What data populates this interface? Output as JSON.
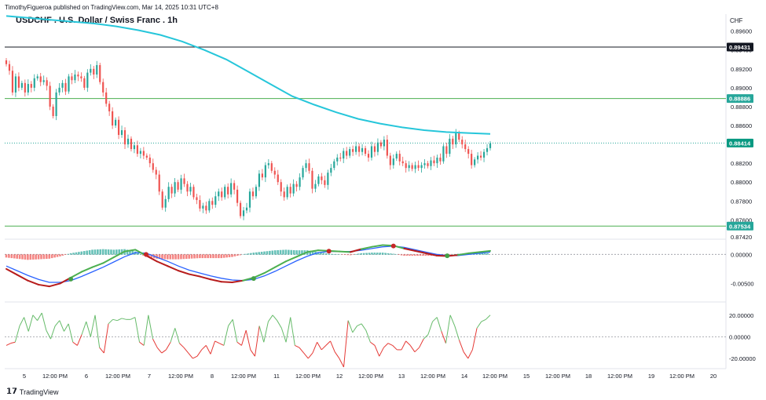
{
  "header": {
    "publisher": "TimothyFigueroa published on TradingView.com, Mar 14, 2025 10:31 UTC+8",
    "title": "USDCHF . U.S. Dollar / Swiss Franc . 1h",
    "currency": "CHF"
  },
  "footer": {
    "brand": "TradingView",
    "logo_icon": "tradingview-logo-icon"
  },
  "colors": {
    "up": "#26a69a",
    "down": "#ef5350",
    "ma": "#26c6da",
    "resistance": "#131722",
    "support": "#4caf50",
    "macd_fast": "#4caf50",
    "macd_slow": "#2962ff",
    "macd_slow_down": "#b71c1c",
    "osc_up": "#66bb6a",
    "osc_down": "#e53935",
    "grid": "#f0f3fa"
  },
  "chart_data": [
    {
      "type": "candlestick",
      "panel": "price",
      "ylim": [
        0.8742,
        0.8978
      ],
      "y_ticks": [
        "0.89600",
        "0.89400",
        "0.89200",
        "0.89000",
        "0.88800",
        "0.88600",
        "0.88400",
        "0.88200",
        "0.88000",
        "0.87800",
        "0.87600",
        "0.87420"
      ],
      "x_ticks": [
        "5",
        "12:00 PM",
        "6",
        "12:00 PM",
        "7",
        "12:00 PM",
        "8",
        "12:00 PM",
        "11",
        "12:00 PM",
        "12",
        "12:00 PM",
        "13",
        "12:00 PM",
        "14",
        "12:00 PM",
        "15",
        "12:00 PM",
        "18",
        "12:00 PM",
        "19",
        "12:00 PM",
        "20"
      ],
      "close_path": [
        0.8925,
        0.8918,
        0.8895,
        0.8912,
        0.89,
        0.8905,
        0.8895,
        0.8904,
        0.89,
        0.891,
        0.8912,
        0.8906,
        0.8908,
        0.8902,
        0.888,
        0.887,
        0.8895,
        0.89,
        0.8905,
        0.8896,
        0.8912,
        0.8908,
        0.8914,
        0.8912,
        0.891,
        0.89,
        0.8916,
        0.892,
        0.8914,
        0.8924,
        0.8906,
        0.8895,
        0.8883,
        0.8875,
        0.886,
        0.8866,
        0.885,
        0.8855,
        0.884,
        0.8846,
        0.8835,
        0.8839,
        0.883,
        0.8833,
        0.8828,
        0.8826,
        0.882,
        0.8813,
        0.8808,
        0.879,
        0.8773,
        0.8782,
        0.8795,
        0.8788,
        0.88,
        0.8792,
        0.8804,
        0.8798,
        0.879,
        0.8795,
        0.8784,
        0.8781,
        0.8772,
        0.8775,
        0.877,
        0.878,
        0.8776,
        0.8785,
        0.879,
        0.8784,
        0.8795,
        0.8787,
        0.8799,
        0.8792,
        0.8778,
        0.8764,
        0.877,
        0.8773,
        0.879,
        0.8785,
        0.8795,
        0.8809,
        0.8805,
        0.8818,
        0.882,
        0.8812,
        0.8808,
        0.88,
        0.879,
        0.8784,
        0.8795,
        0.8788,
        0.8798,
        0.8795,
        0.8805,
        0.8815,
        0.882,
        0.8812,
        0.8793,
        0.8798,
        0.8806,
        0.8802,
        0.8797,
        0.881,
        0.8815,
        0.8822,
        0.8826,
        0.8825,
        0.8833,
        0.8828,
        0.8835,
        0.8832,
        0.8838,
        0.8832,
        0.8836,
        0.883,
        0.8826,
        0.8838,
        0.8832,
        0.8842,
        0.8838,
        0.8845,
        0.8828,
        0.8818,
        0.8825,
        0.883,
        0.8822,
        0.882,
        0.8815,
        0.8818,
        0.8814,
        0.8818,
        0.8815,
        0.8818,
        0.882,
        0.8817,
        0.8823,
        0.882,
        0.8826,
        0.8822,
        0.8838,
        0.883,
        0.8846,
        0.884,
        0.8852,
        0.8845,
        0.884,
        0.8835,
        0.883,
        0.8818,
        0.8824,
        0.8828,
        0.8826,
        0.8832,
        0.8836,
        0.8841
      ],
      "ma_path": [
        0.8976,
        0.8974,
        0.8972,
        0.897,
        0.8968,
        0.8965,
        0.8961,
        0.8956,
        0.8949,
        0.894,
        0.893,
        0.8917,
        0.8904,
        0.8891,
        0.8882,
        0.8874,
        0.8867,
        0.8862,
        0.8858,
        0.8855,
        0.8853,
        0.8852,
        0.8851
      ],
      "levels": [
        {
          "value": 0.89431,
          "label": "0.89431",
          "kind": "resistance"
        },
        {
          "value": 0.88886,
          "label": "0.88886",
          "kind": "support"
        },
        {
          "value": 0.88414,
          "label": "0.88414",
          "kind": "last"
        },
        {
          "value": 0.87534,
          "label": "0.87534",
          "kind": "support"
        }
      ]
    },
    {
      "type": "line",
      "panel": "macd",
      "ylim": [
        -0.0075,
        0.0022
      ],
      "y_ticks": [
        "0.00000",
        "-0.00500"
      ],
      "fast": [
        -0.0025,
        -0.0035,
        -0.0045,
        -0.0052,
        -0.0055,
        -0.005,
        -0.004,
        -0.003,
        -0.0022,
        -0.0015,
        -0.0005,
        0.0005,
        0.0008,
        -0.0002,
        -0.0012,
        -0.002,
        -0.0028,
        -0.0034,
        -0.0038,
        -0.0043,
        -0.0047,
        -0.0048,
        -0.0045,
        -0.004,
        -0.0032,
        -0.0022,
        -0.0012,
        -0.0004,
        0.0004,
        0.0007,
        0.0006,
        0.0005,
        0.0004,
        0.0009,
        0.0013,
        0.0016,
        0.0015,
        0.001,
        0.0006,
        0.0002,
        -0.0002,
        -0.0003,
        -0.0001,
        0.0002,
        0.0004,
        0.0006
      ],
      "slow": [
        -0.002,
        -0.0028,
        -0.0036,
        -0.0043,
        -0.0048,
        -0.0048,
        -0.0045,
        -0.0038,
        -0.003,
        -0.0022,
        -0.0013,
        -0.0004,
        0.0003,
        0.0002,
        -0.0005,
        -0.0012,
        -0.002,
        -0.0027,
        -0.0032,
        -0.0037,
        -0.0041,
        -0.0044,
        -0.0045,
        -0.0043,
        -0.0037,
        -0.0029,
        -0.002,
        -0.0011,
        -0.0003,
        0.0003,
        0.0005,
        0.0005,
        0.0005,
        0.0007,
        0.001,
        0.0013,
        0.0014,
        0.0012,
        0.0008,
        0.0004,
        0.0,
        -0.0002,
        -0.0002,
        0.0,
        0.0002,
        0.0004
      ],
      "histogram": [
        -0.0005,
        -0.0007,
        -0.0009,
        -0.0008,
        -0.0007,
        -0.0003,
        0.0002,
        0.0005,
        0.0008,
        0.0009,
        0.0008,
        0.0009,
        0.0005,
        -0.0004,
        -0.0007,
        -0.0008,
        -0.0008,
        -0.0007,
        -0.0006,
        -0.0006,
        -0.0006,
        -0.0004,
        0.0,
        0.0003,
        0.0005,
        0.0007,
        0.0008,
        0.0007,
        0.0007,
        0.0004,
        0.0001,
        0.0,
        -0.0001,
        0.0002,
        0.0003,
        0.0003,
        0.0001,
        -0.0002,
        -0.0002,
        -0.0002,
        -0.0002,
        -0.0001,
        0.0001,
        0.0002,
        0.0002,
        0.0002
      ],
      "cross_points": [
        {
          "i": 6,
          "dir": "up"
        },
        {
          "i": 13,
          "dir": "down"
        },
        {
          "i": 23,
          "dir": "up"
        },
        {
          "i": 30,
          "dir": "down"
        },
        {
          "i": 36,
          "dir": "down"
        },
        {
          "i": 41,
          "dir": "up"
        }
      ]
    },
    {
      "type": "line",
      "panel": "oscillator",
      "ylim": [
        -28,
        30
      ],
      "y_ticks": [
        "20.00000",
        "0.00000",
        "-20.00000"
      ],
      "values": [
        -8,
        -6,
        -5,
        10,
        18,
        5,
        20,
        15,
        22,
        6,
        -2,
        10,
        15,
        5,
        12,
        -5,
        -8,
        2,
        14,
        0,
        20,
        -10,
        -15,
        12,
        16,
        15,
        17,
        16,
        16,
        18,
        -5,
        -8,
        20,
        -2,
        -10,
        -15,
        -12,
        -5,
        8,
        -6,
        -10,
        -15,
        -20,
        -18,
        -12,
        -8,
        -16,
        -4,
        -6,
        -8,
        10,
        16,
        -5,
        -8,
        6,
        -12,
        -18,
        10,
        -5,
        14,
        20,
        15,
        8,
        -5,
        18,
        -8,
        -10,
        -15,
        -20,
        -15,
        -5,
        -12,
        -8,
        -4,
        -14,
        -20,
        -28,
        15,
        4,
        10,
        12,
        6,
        -5,
        -8,
        -18,
        -10,
        -6,
        -8,
        -12,
        -12,
        -4,
        -8,
        -14,
        -10,
        -2,
        2,
        14,
        18,
        5,
        -6,
        20,
        10,
        -3,
        -14,
        -20,
        -12,
        8,
        14,
        16,
        20
      ],
      "cross_threshold": 0
    }
  ]
}
